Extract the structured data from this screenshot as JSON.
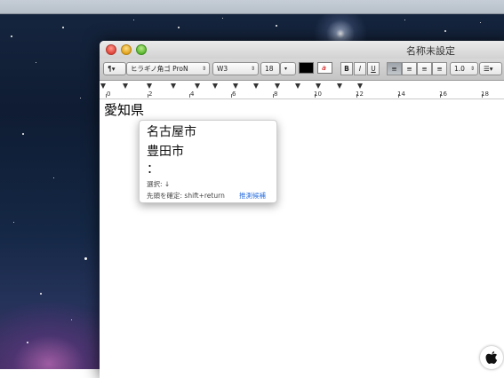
{
  "window": {
    "title": "名称未設定"
  },
  "toolbar": {
    "paragraph_label": "¶▾",
    "font_family": "ヒラギノ角ゴ ProN",
    "font_weight": "W3",
    "font_size": "18",
    "text_color": "#000000",
    "bold": "B",
    "italic": "I",
    "underline": "U",
    "line_spacing": "1.0",
    "list_label": "☰▾"
  },
  "ruler": {
    "labels": [
      "0",
      "2",
      "4",
      "6",
      "8",
      "10",
      "12",
      "14",
      "16",
      "18"
    ]
  },
  "document": {
    "text": "愛知県"
  },
  "candidates": {
    "items": [
      "名古屋市",
      "豊田市",
      "："
    ],
    "select_hint": "選択: ↓",
    "confirm_hint": "先頭を確定: shift+return",
    "predict_link": "推測候補"
  },
  "colors": {
    "link": "#2a6fdc",
    "desktop": "#142744"
  }
}
